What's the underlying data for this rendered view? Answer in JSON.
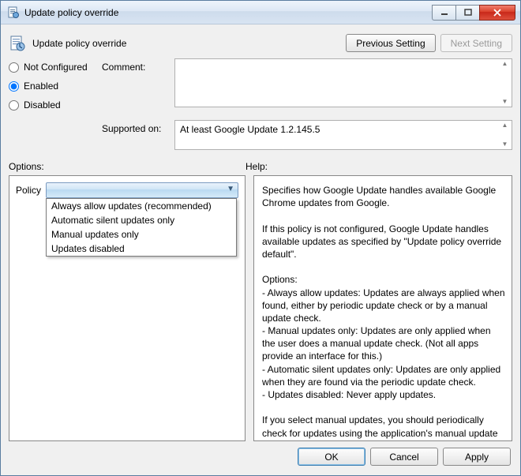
{
  "window": {
    "title": "Update policy override"
  },
  "header": {
    "heading": "Update policy override",
    "prev_label": "Previous Setting",
    "next_label": "Next Setting"
  },
  "state": {
    "not_configured": "Not Configured",
    "enabled": "Enabled",
    "disabled": "Disabled",
    "selected": "enabled"
  },
  "labels": {
    "comment": "Comment:",
    "supported": "Supported on:",
    "options": "Options:",
    "help": "Help:",
    "policy": "Policy"
  },
  "supported_text": "At least Google Update 1.2.145.5",
  "policy_options": [
    "Always allow updates (recommended)",
    "Automatic silent updates only",
    "Manual updates only",
    "Updates disabled"
  ],
  "help_text": "Specifies how Google Update handles available Google Chrome updates from Google.\n\nIf this policy is not configured, Google Update handles available updates as specified by \"Update policy override default\".\n\nOptions:\n - Always allow updates: Updates are always applied when found, either by periodic update check or by a manual update check.\n - Manual updates only: Updates are only applied when the user does a manual update check. (Not all apps provide an interface for this.)\n - Automatic silent updates only: Updates are only applied when they are found via the periodic update check.\n - Updates disabled: Never apply updates.\n\nIf you select manual updates, you should periodically check for updates using the application's manual update mechanism if available. If you disable updates, you should periodically check for updates and distribute them to users. Check http://www.google.com/chrome/.",
  "footer": {
    "ok": "OK",
    "cancel": "Cancel",
    "apply": "Apply"
  }
}
